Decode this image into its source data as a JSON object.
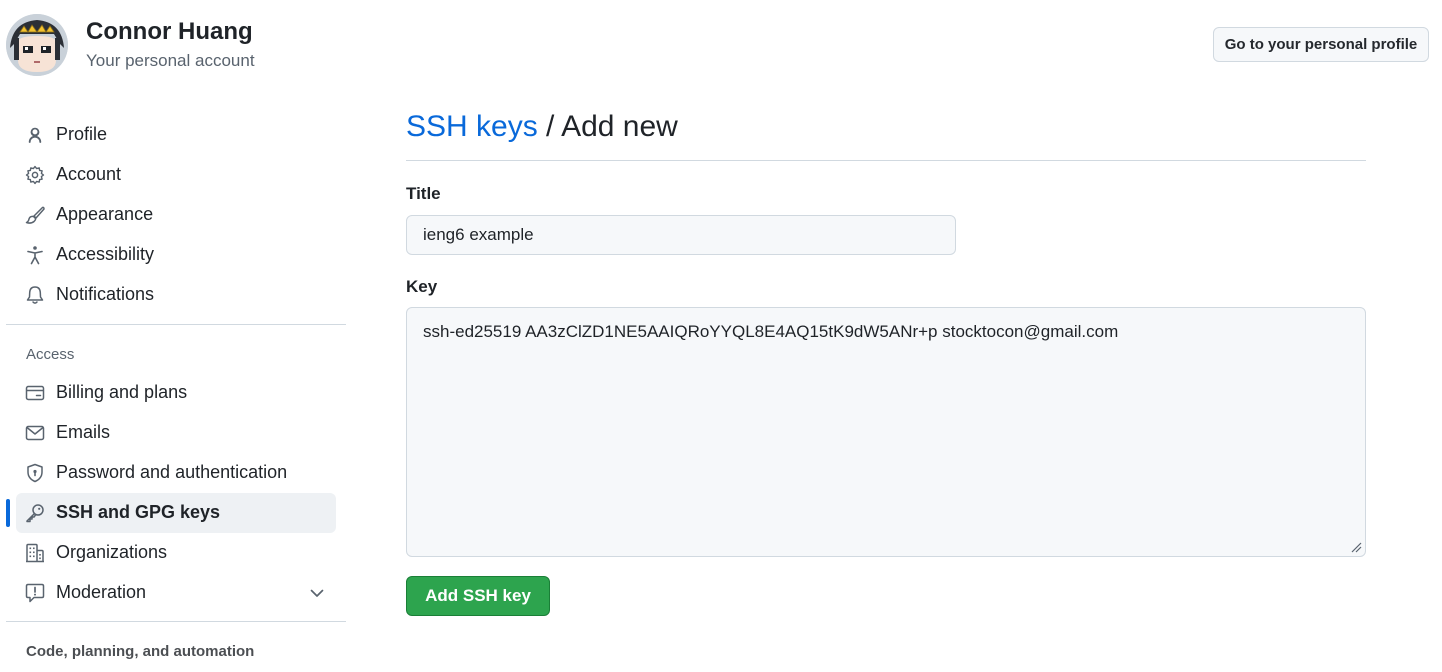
{
  "user": {
    "name": "Connor Huang",
    "subtitle": "Your personal account",
    "profile_button": "Go to your personal profile"
  },
  "sidebar": {
    "items": [
      {
        "label": "Profile",
        "icon": "person-icon"
      },
      {
        "label": "Account",
        "icon": "gear-icon"
      },
      {
        "label": "Appearance",
        "icon": "paintbrush-icon"
      },
      {
        "label": "Accessibility",
        "icon": "accessibility-icon"
      },
      {
        "label": "Notifications",
        "icon": "bell-icon"
      }
    ],
    "access_heading": "Access",
    "access_items": [
      {
        "label": "Billing and plans",
        "icon": "credit-card-icon"
      },
      {
        "label": "Emails",
        "icon": "mail-icon"
      },
      {
        "label": "Password and authentication",
        "icon": "shield-lock-icon"
      },
      {
        "label": "SSH and GPG keys",
        "icon": "key-icon",
        "active": true
      },
      {
        "label": "Organizations",
        "icon": "organization-icon"
      },
      {
        "label": "Moderation",
        "icon": "report-icon",
        "expandable": true
      }
    ],
    "code_heading": "Code, planning, and automation"
  },
  "main": {
    "breadcrumb_link": "SSH keys",
    "breadcrumb_sep": " / ",
    "breadcrumb_current": "Add new",
    "title_label": "Title",
    "title_value": "ieng6 example",
    "key_label": "Key",
    "key_value": "ssh-ed25519 AA3zClZD1NE5AAIQRoYYQL8E4AQ15tK9dW5ANr+p stocktocon@gmail.com",
    "submit_label": "Add SSH key"
  },
  "colors": {
    "accent": "#0969da",
    "primary_button": "#2da44e",
    "muted_text": "#59636e"
  }
}
